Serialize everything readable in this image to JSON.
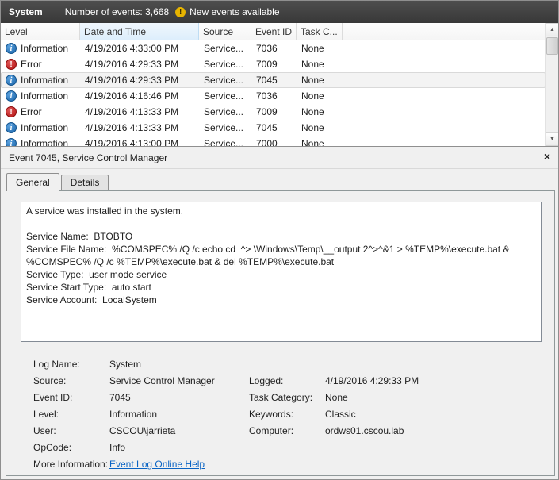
{
  "header": {
    "log_name": "System",
    "events_count": "Number of events: 3,668",
    "new_events_label": "New events available"
  },
  "table": {
    "columns": [
      "Level",
      "Date and Time",
      "Source",
      "Event ID",
      "Task C..."
    ],
    "rows": [
      {
        "icon": "information",
        "level": "Information",
        "datetime": "4/19/2016 4:33:00 PM",
        "source": "Service...",
        "event_id": "7036",
        "task": "None"
      },
      {
        "icon": "error",
        "level": "Error",
        "datetime": "4/19/2016 4:29:33 PM",
        "source": "Service...",
        "event_id": "7009",
        "task": "None"
      },
      {
        "icon": "information",
        "level": "Information",
        "datetime": "4/19/2016 4:29:33 PM",
        "source": "Service...",
        "event_id": "7045",
        "task": "None"
      },
      {
        "icon": "information",
        "level": "Information",
        "datetime": "4/19/2016 4:16:46 PM",
        "source": "Service...",
        "event_id": "7036",
        "task": "None"
      },
      {
        "icon": "error",
        "level": "Error",
        "datetime": "4/19/2016 4:13:33 PM",
        "source": "Service...",
        "event_id": "7009",
        "task": "None"
      },
      {
        "icon": "information",
        "level": "Information",
        "datetime": "4/19/2016 4:13:33 PM",
        "source": "Service...",
        "event_id": "7045",
        "task": "None"
      },
      {
        "icon": "information",
        "level": "Information",
        "datetime": "4/19/2016 4:13:00 PM",
        "source": "Service...",
        "event_id": "7000",
        "task": "None"
      }
    ]
  },
  "detail": {
    "title": "Event 7045, Service Control Manager",
    "tabs": {
      "general": "General",
      "details": "Details"
    },
    "message": "A service was installed in the system.\n\nService Name:  BTOBTO\nService File Name:  %COMSPEC% /Q /c echo cd  ^> \\Windows\\Temp\\__output 2^>^&1 > %TEMP%\\execute.bat & %COMSPEC% /Q /c %TEMP%\\execute.bat & del %TEMP%\\execute.bat\nService Type:  user mode service\nService Start Type:  auto start\nService Account:  LocalSystem",
    "fields": {
      "log_name_label": "Log Name:",
      "log_name": "System",
      "source_label": "Source:",
      "source": "Service Control Manager",
      "logged_label": "Logged:",
      "logged": "4/19/2016 4:29:33 PM",
      "event_id_label": "Event ID:",
      "event_id": "7045",
      "task_category_label": "Task Category:",
      "task_category": "None",
      "level_label": "Level:",
      "level": "Information",
      "keywords_label": "Keywords:",
      "keywords": "Classic",
      "user_label": "User:",
      "user": "CSCOU\\jarrieta",
      "computer_label": "Computer:",
      "computer": "ordws01.cscou.lab",
      "opcode_label": "OpCode:",
      "opcode": "Info",
      "more_info_label": "More Information:",
      "more_info_link": "Event Log Online Help"
    },
    "colors": {
      "link": "#0a64c4",
      "error": "#b51212",
      "information": "#1963a8"
    }
  }
}
